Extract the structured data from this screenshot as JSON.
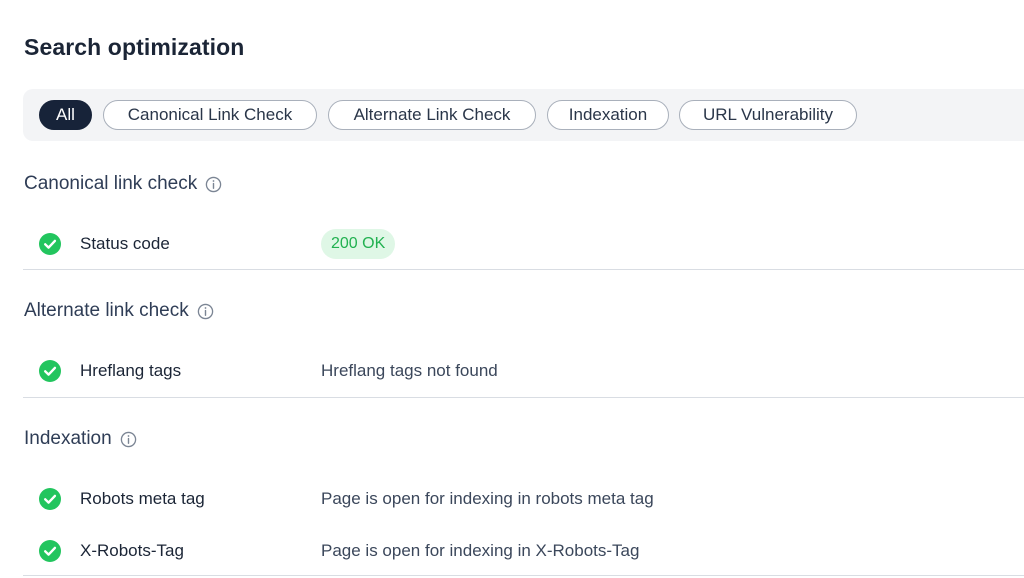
{
  "page": {
    "title": "Search optimization"
  },
  "filters": [
    {
      "label": "All",
      "active": true
    },
    {
      "label": "Canonical Link Check",
      "active": false
    },
    {
      "label": "Alternate Link Check",
      "active": false
    },
    {
      "label": "Indexation",
      "active": false
    },
    {
      "label": "URL Vulnerability",
      "active": false
    }
  ],
  "sections": {
    "canonical": {
      "title": "Canonical link check",
      "rows": [
        {
          "label": "Status code",
          "value": "200 OK",
          "status": "pass"
        }
      ]
    },
    "alternate": {
      "title": "Alternate link check",
      "rows": [
        {
          "label": "Hreflang tags",
          "value": "Hreflang tags not found",
          "status": "pass"
        }
      ]
    },
    "indexation": {
      "title": "Indexation",
      "rows": [
        {
          "label": "Robots meta tag",
          "value": "Page is open for indexing in robots meta tag",
          "status": "pass"
        },
        {
          "label": "X-Robots-Tag",
          "value": "Page is open for indexing in X-Robots-Tag",
          "status": "pass"
        }
      ]
    }
  },
  "icons": {
    "check": "check-circle-icon",
    "info": "info-icon"
  },
  "colors": {
    "accent_dark": "#172339",
    "success": "#21b150",
    "success_bg": "#dff7e6"
  }
}
